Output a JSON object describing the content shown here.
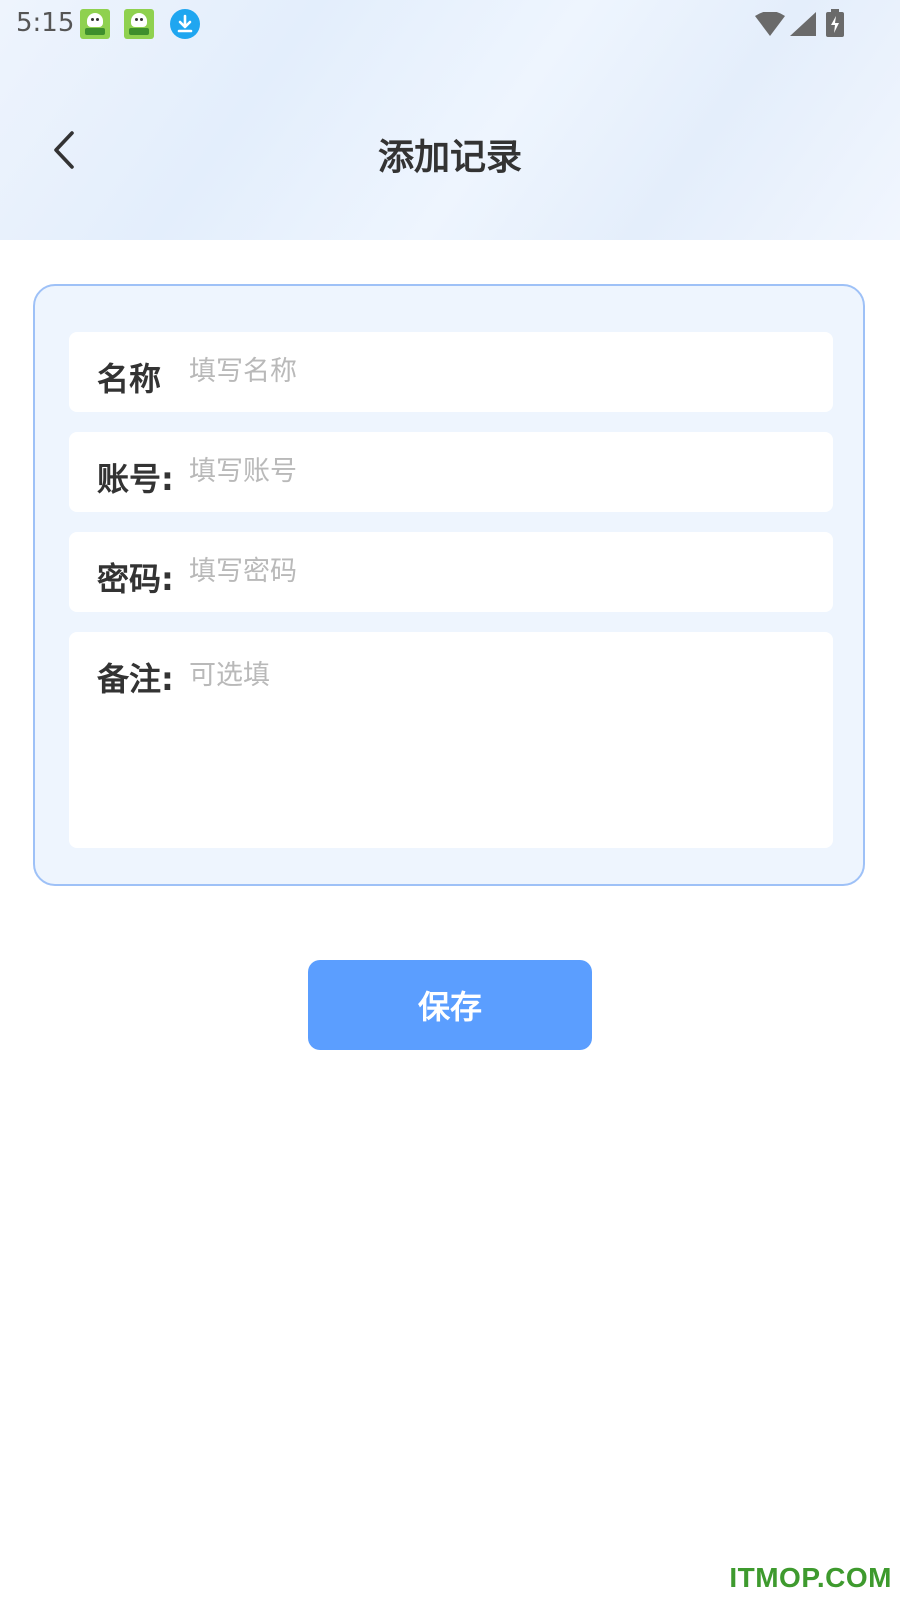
{
  "status_bar": {
    "time": "5:15",
    "icons": [
      "app-notification-icon",
      "app-notification-icon",
      "download-icon",
      "wifi-icon",
      "signal-icon",
      "battery-charging-icon"
    ]
  },
  "header": {
    "title": "添加记录",
    "back_icon": "chevron-left-icon"
  },
  "form": {
    "fields": [
      {
        "label": "名称",
        "placeholder": "填写名称",
        "value": ""
      },
      {
        "label": "账号:",
        "placeholder": "填写账号",
        "value": ""
      },
      {
        "label": "密码:",
        "placeholder": "填写密码",
        "value": ""
      },
      {
        "label": "备注:",
        "placeholder": "可选填",
        "value": ""
      }
    ]
  },
  "actions": {
    "save_label": "保存"
  },
  "watermark": "ITMOP.COM",
  "colors": {
    "accent": "#5b9eff",
    "card_border": "#9ec1f7",
    "card_background": "#eef5fe",
    "watermark": "#3e9a2e"
  }
}
